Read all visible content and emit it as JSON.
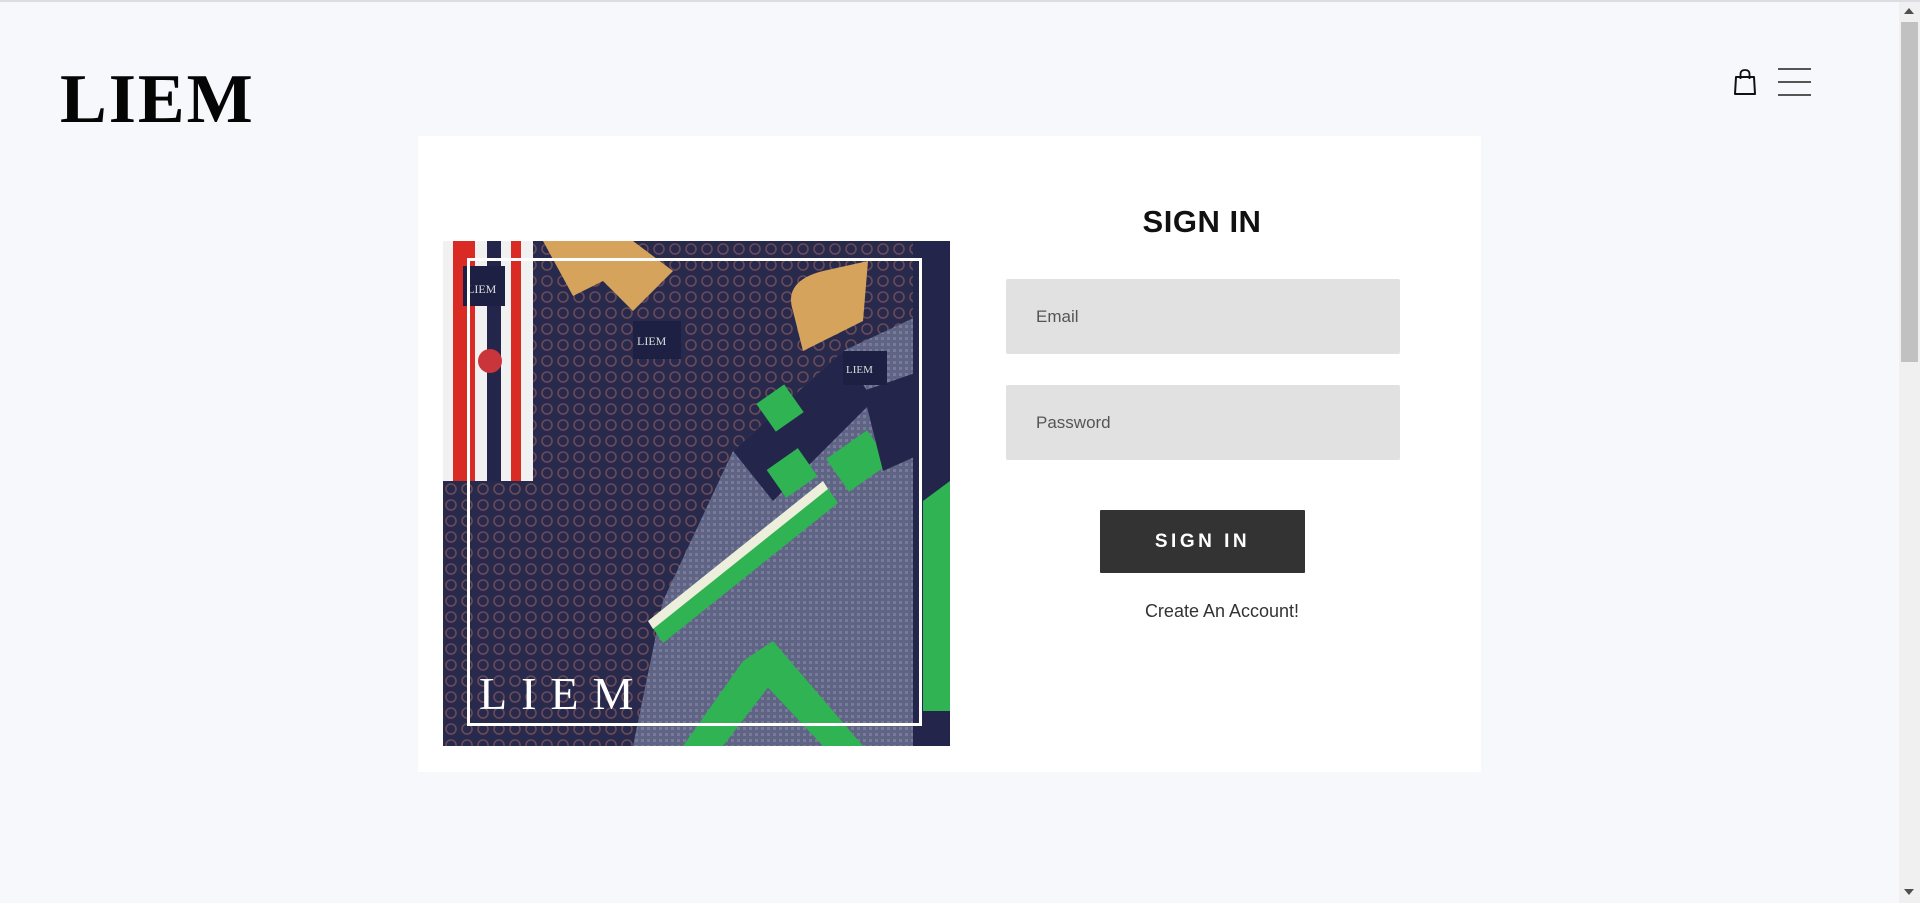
{
  "brand": {
    "logo_text": "LIEM"
  },
  "header": {
    "cart_icon": "shopping-bag-icon",
    "menu_icon": "hamburger-menu-icon"
  },
  "hero_image": {
    "logo_text": "LIEM",
    "description_colors": {
      "navy": "#262a4a",
      "green": "#2fb353",
      "red": "#d92b23",
      "wood": "#d6a35d"
    }
  },
  "signin": {
    "title": "SIGN IN",
    "email_placeholder": "Email",
    "password_placeholder": "Password",
    "submit_label": "SIGN IN",
    "create_account_label": "Create An Account!"
  },
  "colors": {
    "page_bg": "#f7f8fc",
    "card_bg": "#ffffff",
    "input_bg": "#e1e1e1",
    "button_bg": "#333333",
    "button_text": "#ffffff"
  }
}
